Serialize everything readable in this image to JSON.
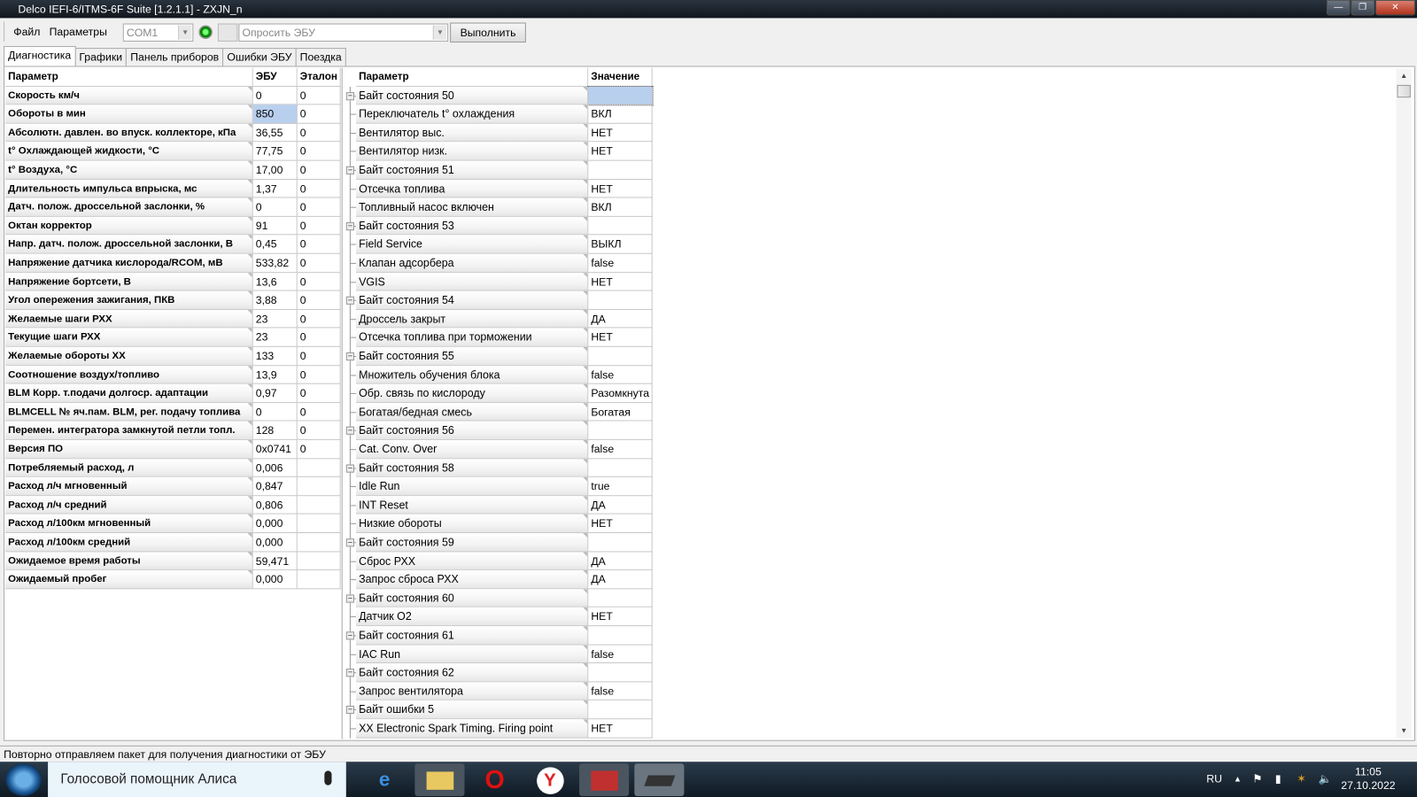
{
  "window": {
    "title": "Delco IEFI-6/ITMS-6F Suite [1.2.1.1] - ZXJN_n",
    "minimize": "—",
    "maximize": "❐",
    "close": "✕"
  },
  "menu": [
    "Файл",
    "Параметры"
  ],
  "toolbar": {
    "port": "COM1",
    "command": "Опросить ЭБУ",
    "execute": "Выполнить",
    "connection_status_color": "#22aa22"
  },
  "tabs": [
    "Диагностика",
    "Графики",
    "Панель приборов",
    "Ошибки ЭБУ",
    "Поездка"
  ],
  "left_table": {
    "headers": [
      "Параметр",
      "ЭБУ",
      "Эталон"
    ],
    "rows": [
      [
        "Скорость км/ч",
        "0",
        "0"
      ],
      [
        "Обороты в мин",
        "850",
        "0"
      ],
      [
        "Абсолютн. давлен. во впуск. коллекторе, кПа",
        "36,55",
        "0"
      ],
      [
        "t° Охлаждающей жидкости, °С",
        "77,75",
        "0"
      ],
      [
        "t° Воздуха, °С",
        "17,00",
        "0"
      ],
      [
        "Длительность импульса впрыска, мс",
        "1,37",
        "0"
      ],
      [
        "Датч. полож. дроссельной заслонки, %",
        "0",
        "0"
      ],
      [
        "Октан корректор",
        "91",
        "0"
      ],
      [
        "Напр. датч. полож. дроссельной заслонки, В",
        "0,45",
        "0"
      ],
      [
        "Напряжение датчика кислорода/RCOM, мВ",
        "533,82",
        "0"
      ],
      [
        "Напряжение бортсети, В",
        "13,6",
        "0"
      ],
      [
        "Угол опережения зажигания, ПКВ",
        "3,88",
        "0"
      ],
      [
        "Желаемые шаги РХХ",
        "23",
        "0"
      ],
      [
        "Текущие шаги РХХ",
        "23",
        "0"
      ],
      [
        "Желаемые обороты ХХ",
        "133",
        "0"
      ],
      [
        "Соотношение воздух/топливо",
        "13,9",
        "0"
      ],
      [
        "BLM Корр. т.подачи долгоср. адаптации",
        "0,97",
        "0"
      ],
      [
        "BLMCELL № яч.пам. BLM, рег. подачу топлива",
        "0",
        "0"
      ],
      [
        "Перемен. интегратора замкнутой петли топл.",
        "128",
        "0"
      ],
      [
        "Версия ПО",
        "0x0741",
        "0"
      ],
      [
        "Потребляемый расход, л",
        "0,006",
        ""
      ],
      [
        "Расход л/ч мгновенный",
        "0,847",
        ""
      ],
      [
        "Расход л/ч средний",
        "0,806",
        ""
      ],
      [
        "Расход л/100км мгновенный",
        "0,000",
        ""
      ],
      [
        "Расход л/100км средний",
        "0,000",
        ""
      ],
      [
        "Ожидаемое время работы",
        "59,471",
        ""
      ],
      [
        "Ожидаемый пробег",
        "0,000",
        ""
      ]
    ]
  },
  "right_table": {
    "headers": [
      "Параметр",
      "Значение"
    ],
    "rows": [
      [
        "Байт состояния 50",
        "",
        true
      ],
      [
        "Переключатель t° охлаждения",
        "ВКЛ",
        false
      ],
      [
        "Вентилятор выс.",
        "НЕТ",
        false
      ],
      [
        "Вентилятор низк.",
        "НЕТ",
        false
      ],
      [
        "Байт состояния 51",
        "",
        true
      ],
      [
        "Отсечка топлива",
        "НЕТ",
        false
      ],
      [
        "Топливный насос включен",
        "ВКЛ",
        false
      ],
      [
        "Байт состояния 53",
        "",
        true
      ],
      [
        "Field Service",
        "ВЫКЛ",
        false
      ],
      [
        "Клапан адсорбера",
        "false",
        false
      ],
      [
        "VGIS",
        "НЕТ",
        false
      ],
      [
        "Байт состояния 54",
        "",
        true
      ],
      [
        "Дроссель закрыт",
        "ДА",
        false
      ],
      [
        "Отсечка топлива при торможении",
        "НЕТ",
        false
      ],
      [
        "Байт состояния 55",
        "",
        true
      ],
      [
        "Множитель обучения блока",
        "false",
        false
      ],
      [
        "Обр. связь по кислороду",
        "Разомкнута",
        false
      ],
      [
        "Богатая/бедная смесь",
        "Богатая",
        false
      ],
      [
        "Байт состояния 56",
        "",
        true
      ],
      [
        "Cat. Conv. Over",
        "false",
        false
      ],
      [
        "Байт состояния 58",
        "",
        true
      ],
      [
        "Idle Run",
        "true",
        false
      ],
      [
        "INT Reset",
        "ДА",
        false
      ],
      [
        "Низкие обороты",
        "НЕТ",
        false
      ],
      [
        "Байт состояния 59",
        "",
        true
      ],
      [
        "Сброс РХХ",
        "ДА",
        false
      ],
      [
        "Запрос сброса РХХ",
        "ДА",
        false
      ],
      [
        "Байт состояния 60",
        "",
        true
      ],
      [
        "Датчик O2",
        "НЕТ",
        false
      ],
      [
        "Байт состояния 61",
        "",
        true
      ],
      [
        "IAC Run",
        "false",
        false
      ],
      [
        "Байт состояния 62",
        "",
        true
      ],
      [
        "Запрос вентилятора",
        "false",
        false
      ],
      [
        "Байт ошибки 5",
        "",
        true
      ],
      [
        "XX Electronic Spark Timing. Firing point",
        "НЕТ",
        false
      ]
    ]
  },
  "status_bar": "Повторно отправляем пакет для получения диагностики от ЭБУ",
  "taskbar": {
    "search_placeholder": "Голосовой помощник Алиса",
    "language": "RU",
    "time": "11:05",
    "date": "27.10.2022"
  }
}
